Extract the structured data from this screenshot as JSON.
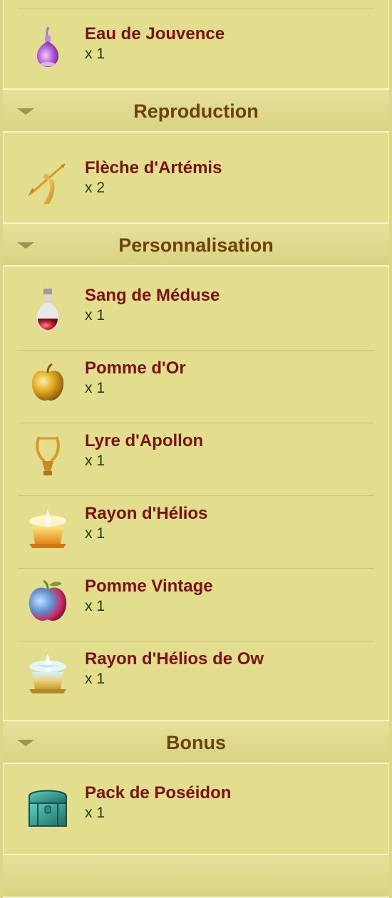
{
  "sections": [
    {
      "items": [
        {
          "name": "Eau de Jouvence",
          "qty": "x 1",
          "icon": "potion-bottle-icon"
        }
      ]
    },
    {
      "title": "Reproduction",
      "items": [
        {
          "name": "Flèche d'Artémis",
          "qty": "x 2",
          "icon": "arrow-icon"
        }
      ]
    },
    {
      "title": "Personnalisation",
      "items": [
        {
          "name": "Sang de Méduse",
          "qty": "x 1",
          "icon": "blood-flask-icon"
        },
        {
          "name": "Pomme d'Or",
          "qty": "x 1",
          "icon": "golden-apple-icon"
        },
        {
          "name": "Lyre d'Apollon",
          "qty": "x 1",
          "icon": "lyre-icon"
        },
        {
          "name": "Rayon d'Hélios",
          "qty": "x 1",
          "icon": "sun-ray-icon"
        },
        {
          "name": "Pomme Vintage",
          "qty": "x 1",
          "icon": "vintage-apple-icon"
        },
        {
          "name": "Rayon d'Hélios de Ow",
          "qty": "x 1",
          "icon": "sun-ray-ow-icon"
        }
      ]
    },
    {
      "title": "Bonus",
      "items": [
        {
          "name": "Pack de Poséidon",
          "qty": "x 1",
          "icon": "chest-icon"
        }
      ]
    }
  ],
  "colors": {
    "background": "#e3dd8e",
    "header_text": "#6e430b",
    "item_name": "#7a1212",
    "item_qty": "#1f3d12",
    "separator": "#c9c27a"
  }
}
